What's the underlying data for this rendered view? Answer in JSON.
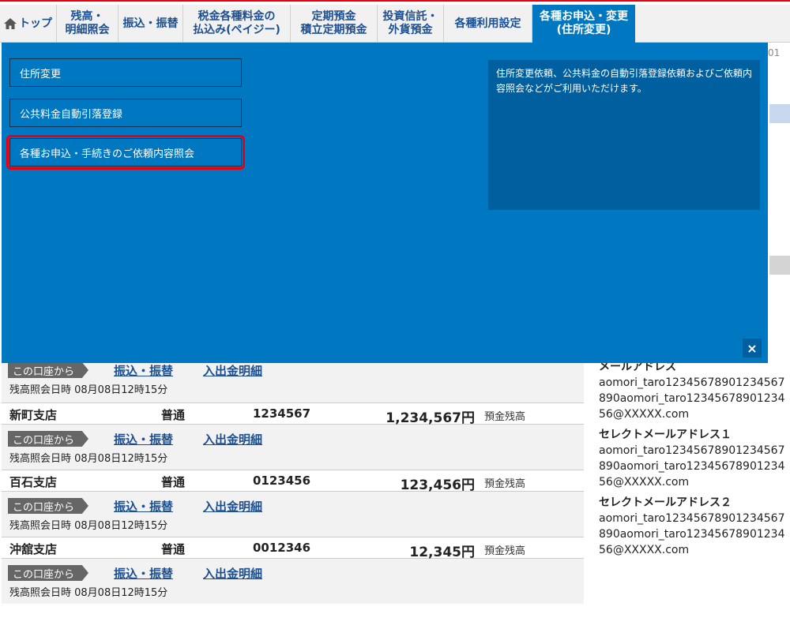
{
  "nav": {
    "home": "トップ",
    "balance": [
      "残高・",
      "明細照会"
    ],
    "transfer": "振込・振替",
    "tax": [
      "税金各種料金の",
      "払込み(ペイジー)"
    ],
    "deposit": [
      "定期預金",
      "積立定期預金"
    ],
    "invest": [
      "投資信託・",
      "外貨預金"
    ],
    "settings": "各種利用設定",
    "apply": [
      "各種お申込・変更",
      "(住所変更)"
    ]
  },
  "stray_text": "01",
  "panel": {
    "links": [
      "住所変更",
      "公共料金自動引落登録",
      "各種お申込・手続きのご依頼内容照会"
    ],
    "description": "住所変更依頼、公共料金の自動引落登録依頼およびご依頼内容照会などがご利用いただけます。",
    "close": "×"
  },
  "accounts": [
    {
      "branch": "",
      "type": "",
      "number": "",
      "balance": "",
      "label": "",
      "from": "この口座から",
      "transfer": "振込・振替",
      "detail": "入出金明細",
      "time": "残高照会日時 08月08日12時15分"
    },
    {
      "branch": "新町支店",
      "type": "普通",
      "number": "1234567",
      "balance": "1,234,567円",
      "label": "預金残高",
      "from": "この口座から",
      "transfer": "振込・振替",
      "detail": "入出金明細",
      "time": "残高照会日時 08月08日12時15分"
    },
    {
      "branch": "百石支店",
      "type": "普通",
      "number": "0123456",
      "balance": "123,456円",
      "label": "預金残高",
      "from": "この口座から",
      "transfer": "振込・振替",
      "detail": "入出金明細",
      "time": "残高照会日時 08月08日12時15分"
    },
    {
      "branch": "沖舘支店",
      "type": "普通",
      "number": "0012346",
      "balance": "12,345円",
      "label": "預金残高",
      "from": "この口座から",
      "transfer": "振込・振替",
      "detail": "入出金明細",
      "time": "残高照会日時 08月08日12時15分"
    }
  ],
  "mail": {
    "h1": "メールアドレス",
    "v1": "aomori_taro12345678901234567890aomori_taro1234567890123456@XXXXX.com",
    "h2": "セレクトメールアドレス１",
    "v2": "aomori_taro12345678901234567890aomori_taro1234567890123456@XXXXX.com",
    "h3": "セレクトメールアドレス２",
    "v3": "aomori_taro12345678901234567890aomori_taro1234567890123456@XXXXX.com"
  },
  "colors": {
    "accent_blue": "#0078c1",
    "nav_text": "#1b4f91",
    "highlight_red": "#e60012"
  }
}
